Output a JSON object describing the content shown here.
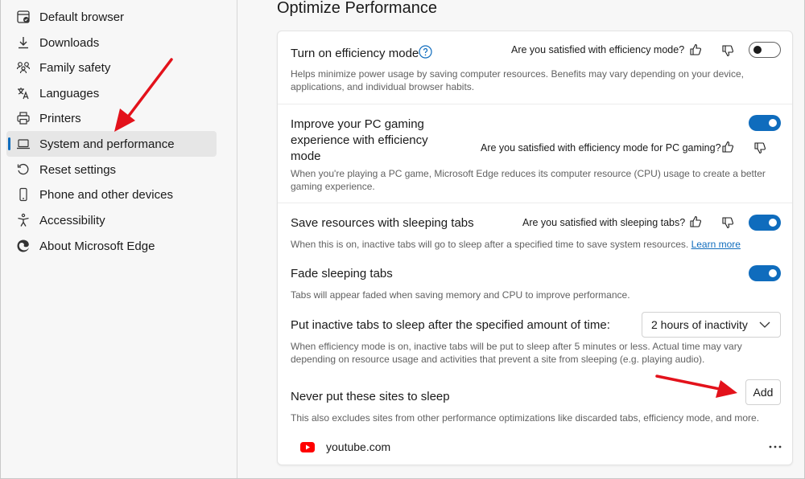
{
  "sidebar": {
    "items": [
      {
        "label": "Default browser",
        "icon": "default-browser-icon"
      },
      {
        "label": "Downloads",
        "icon": "download-icon"
      },
      {
        "label": "Family safety",
        "icon": "family-icon"
      },
      {
        "label": "Languages",
        "icon": "languages-icon"
      },
      {
        "label": "Printers",
        "icon": "printer-icon"
      },
      {
        "label": "System and performance",
        "icon": "laptop-icon",
        "active": true
      },
      {
        "label": "Reset settings",
        "icon": "reset-icon"
      },
      {
        "label": "Phone and other devices",
        "icon": "phone-icon"
      },
      {
        "label": "Accessibility",
        "icon": "accessibility-icon"
      },
      {
        "label": "About Microsoft Edge",
        "icon": "edge-logo-icon"
      }
    ]
  },
  "main": {
    "title": "Optimize Performance",
    "efficiency": {
      "title": "Turn on efficiency mode",
      "feedback": "Are you satisfied with efficiency mode?",
      "desc": "Helps minimize power usage by saving computer resources. Benefits may vary depending on your device, applications, and individual browser habits.",
      "enabled": false
    },
    "gaming": {
      "title": "Improve your PC gaming experience with efficiency mode",
      "feedback": "Are you satisfied with efficiency mode for PC gaming?",
      "desc": "When you're playing a PC game, Microsoft Edge reduces its computer resource (CPU) usage to create a better gaming experience.",
      "enabled": true
    },
    "sleeping": {
      "title": "Save resources with sleeping tabs",
      "feedback": "Are you satisfied with sleeping tabs?",
      "desc": "When this is on, inactive tabs will go to sleep after a specified time to save system resources.",
      "link": "Learn more",
      "enabled": true
    },
    "fade": {
      "title": "Fade sleeping tabs",
      "desc": "Tabs will appear faded when saving memory and CPU to improve performance.",
      "enabled": true
    },
    "inactive": {
      "title": "Put inactive tabs to sleep after the specified amount of time:",
      "selected": "2 hours of inactivity",
      "desc": "When efficiency mode is on, inactive tabs will be put to sleep after 5 minutes or less. Actual time may vary depending on resource usage and activities that prevent a site from sleeping (e.g. playing audio)."
    },
    "never": {
      "title": "Never put these sites to sleep",
      "button": "Add",
      "desc": "This also excludes sites from other performance optimizations like discarded tabs, efficiency mode, and more.",
      "sites": [
        "youtube.com"
      ]
    }
  },
  "colors": {
    "accent": "#0f6cbd",
    "annotation_arrow": "#e3121b",
    "youtube_red": "#ff0000"
  }
}
